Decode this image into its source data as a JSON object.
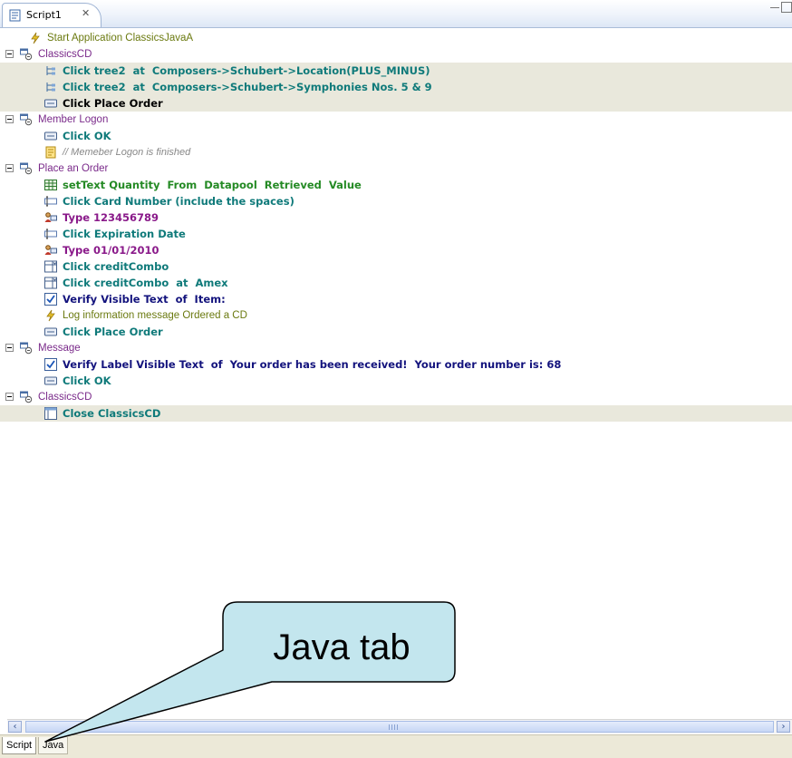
{
  "editor": {
    "tab_label": "Script1",
    "tab_close": "✕"
  },
  "tree": [
    {
      "kind": "step",
      "icon": "log-icon",
      "verb": "",
      "text": "Start Application ClassicsJavaA",
      "style": "plain-olive",
      "indent": 1,
      "highlight": false
    },
    {
      "kind": "group",
      "icon": "window-group-icon",
      "text": "ClassicsCD",
      "indent": 0,
      "highlight": false
    },
    {
      "kind": "step",
      "icon": "tree-icon",
      "verb": "Click",
      "text": "tree2  at  Composers->Schubert->Location(PLUS_MINUS)",
      "style": "teal",
      "indent": 2,
      "highlight": true
    },
    {
      "kind": "step",
      "icon": "tree-icon",
      "verb": "Click",
      "text": "tree2  at  Composers->Schubert->Symphonies Nos. 5 & 9",
      "style": "teal",
      "indent": 2,
      "highlight": true
    },
    {
      "kind": "step",
      "icon": "button-icon",
      "verb": "Click",
      "text": "Place Order",
      "style": "blk",
      "indent": 2,
      "highlight": true
    },
    {
      "kind": "group",
      "icon": "window-group-icon",
      "text": "Member Logon",
      "indent": 0,
      "highlight": false
    },
    {
      "kind": "step",
      "icon": "button-icon",
      "verb": "Click",
      "text": "OK",
      "style": "teal",
      "indent": 2,
      "highlight": false
    },
    {
      "kind": "comment",
      "icon": "comment-icon",
      "text": "// Memeber Logon is finished",
      "indent": 2,
      "highlight": false
    },
    {
      "kind": "group",
      "icon": "window-group-icon",
      "text": "Place an Order",
      "indent": 0,
      "highlight": false
    },
    {
      "kind": "step",
      "icon": "datapool-icon",
      "verb": "setText",
      "text": "Quantity  From  Datapool  Retrieved  Value",
      "style": "grn",
      "indent": 2,
      "highlight": false
    },
    {
      "kind": "step",
      "icon": "textfield-icon",
      "verb": "Click",
      "text": "Card Number (include the spaces)",
      "style": "teal",
      "indent": 2,
      "highlight": false
    },
    {
      "kind": "step",
      "icon": "type-icon",
      "verb": "Type",
      "text": "123456789",
      "style": "pur",
      "indent": 2,
      "highlight": false
    },
    {
      "kind": "step",
      "icon": "textfield-icon",
      "verb": "Click",
      "text": "Expiration Date",
      "style": "teal",
      "indent": 2,
      "highlight": false
    },
    {
      "kind": "step",
      "icon": "type-icon",
      "verb": "Type",
      "text": "01/01/2010",
      "style": "pur",
      "indent": 2,
      "highlight": false
    },
    {
      "kind": "step",
      "icon": "combo-icon",
      "verb": "Click",
      "text": "creditCombo",
      "style": "teal",
      "indent": 2,
      "highlight": false
    },
    {
      "kind": "step",
      "icon": "combo-icon",
      "verb": "Click",
      "text": "creditCombo  at  Amex",
      "style": "teal",
      "indent": 2,
      "highlight": false
    },
    {
      "kind": "step",
      "icon": "verify-icon",
      "verb": "Verify",
      "text": "Visible Text  of  Item:",
      "style": "navy",
      "indent": 2,
      "highlight": false
    },
    {
      "kind": "step",
      "icon": "log-icon",
      "verb": "",
      "text": "Log information message  Ordered a CD",
      "style": "plain-olive",
      "indent": 2,
      "highlight": false
    },
    {
      "kind": "step",
      "icon": "button-icon",
      "verb": "Click",
      "text": "Place Order",
      "style": "teal",
      "indent": 2,
      "highlight": false
    },
    {
      "kind": "group",
      "icon": "window-group-icon",
      "text": "Message",
      "indent": 0,
      "highlight": false
    },
    {
      "kind": "step",
      "icon": "verify-icon",
      "verb": "Verify",
      "text": "Label Visible Text  of  Your order has been received!  Your order number is: 68",
      "style": "navy",
      "indent": 2,
      "highlight": false
    },
    {
      "kind": "step",
      "icon": "button-icon",
      "verb": "Click",
      "text": "OK",
      "style": "teal",
      "indent": 2,
      "highlight": false
    },
    {
      "kind": "group",
      "icon": "window-group-icon",
      "text": "ClassicsCD",
      "indent": 0,
      "highlight": false
    },
    {
      "kind": "step",
      "icon": "window-icon",
      "verb": "Close",
      "text": "ClassicsCD",
      "style": "teal",
      "indent": 2,
      "highlight": true
    }
  ],
  "scrollbar": {
    "left": "‹",
    "right": "›"
  },
  "bottom_tabs": {
    "script": "Script",
    "java": "Java"
  },
  "callout": {
    "text": "Java tab"
  }
}
